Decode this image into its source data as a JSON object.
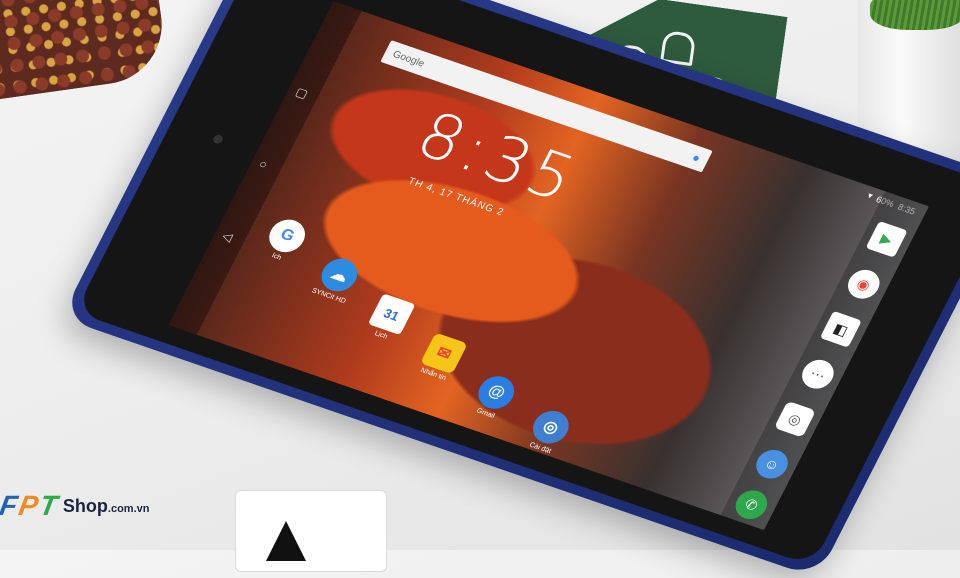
{
  "status_bar": {
    "battery": "60%",
    "time": "8:35"
  },
  "search": {
    "placeholder": "Google"
  },
  "clock": {
    "time": "8:35",
    "date": "TH 4, 17 THÁNG 2"
  },
  "apps": [
    {
      "label": "ích"
    },
    {
      "label": "SYNCit HD"
    },
    {
      "label": "Lịch"
    },
    {
      "label": "Nhắn tin"
    },
    {
      "label": "Gmail"
    },
    {
      "label": "Cài đặt"
    }
  ],
  "calendar_day": "31",
  "watermark": {
    "brand_letters": [
      "F",
      "P",
      "T"
    ],
    "shop": "Shop",
    "domain": ".com.vn"
  }
}
